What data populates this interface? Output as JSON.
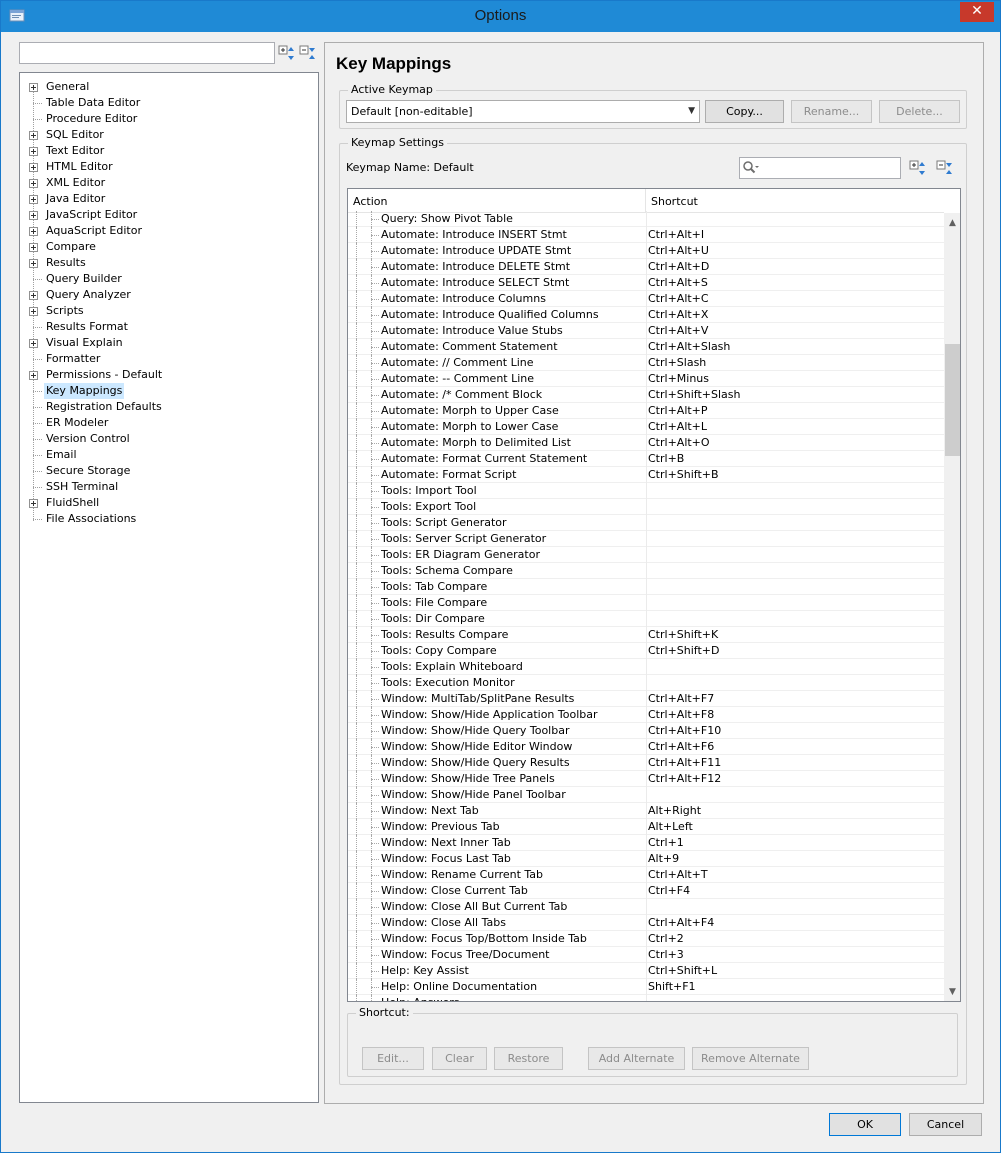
{
  "window": {
    "title": "Options",
    "close_glyph": "✕"
  },
  "nav": {
    "search_value": "",
    "items": [
      {
        "label": "General",
        "expandable": true
      },
      {
        "label": "Table Data Editor",
        "expandable": false
      },
      {
        "label": "Procedure Editor",
        "expandable": false
      },
      {
        "label": "SQL Editor",
        "expandable": true
      },
      {
        "label": "Text Editor",
        "expandable": true
      },
      {
        "label": "HTML Editor",
        "expandable": true
      },
      {
        "label": "XML Editor",
        "expandable": true
      },
      {
        "label": "Java Editor",
        "expandable": true
      },
      {
        "label": "JavaScript Editor",
        "expandable": true
      },
      {
        "label": "AquaScript Editor",
        "expandable": true
      },
      {
        "label": "Compare",
        "expandable": true
      },
      {
        "label": "Results",
        "expandable": true
      },
      {
        "label": "Query Builder",
        "expandable": false
      },
      {
        "label": "Query Analyzer",
        "expandable": true
      },
      {
        "label": "Scripts",
        "expandable": true
      },
      {
        "label": "Results Format",
        "expandable": false
      },
      {
        "label": "Visual Explain",
        "expandable": true
      },
      {
        "label": "Formatter",
        "expandable": false
      },
      {
        "label": "Permissions - Default",
        "expandable": true
      },
      {
        "label": "Key Mappings",
        "expandable": false,
        "selected": true
      },
      {
        "label": "Registration Defaults",
        "expandable": false
      },
      {
        "label": "ER Modeler",
        "expandable": false
      },
      {
        "label": "Version Control",
        "expandable": false
      },
      {
        "label": "Email",
        "expandable": false
      },
      {
        "label": "Secure Storage",
        "expandable": false
      },
      {
        "label": "SSH Terminal",
        "expandable": false
      },
      {
        "label": "FluidShell",
        "expandable": true
      },
      {
        "label": "File Associations",
        "expandable": false
      }
    ]
  },
  "page": {
    "title": "Key Mappings",
    "active_keymap": {
      "legend": "Active Keymap",
      "selected": "Default [non-editable]",
      "copy_label": "Copy...",
      "rename_label": "Rename...",
      "delete_label": "Delete..."
    },
    "settings": {
      "legend": "Keymap Settings",
      "keymap_name": "Keymap Name: Default",
      "filter_value": ""
    },
    "table": {
      "columns": [
        "Action",
        "Shortcut"
      ],
      "rows": [
        {
          "action": "Query: Show Pivot Table",
          "shortcut": ""
        },
        {
          "action": "Automate: Introduce INSERT Stmt",
          "shortcut": "Ctrl+Alt+I"
        },
        {
          "action": "Automate: Introduce UPDATE Stmt",
          "shortcut": "Ctrl+Alt+U"
        },
        {
          "action": "Automate: Introduce DELETE Stmt",
          "shortcut": "Ctrl+Alt+D"
        },
        {
          "action": "Automate: Introduce SELECT Stmt",
          "shortcut": "Ctrl+Alt+S"
        },
        {
          "action": "Automate: Introduce Columns",
          "shortcut": "Ctrl+Alt+C"
        },
        {
          "action": "Automate: Introduce Qualified Columns",
          "shortcut": "Ctrl+Alt+X"
        },
        {
          "action": "Automate: Introduce Value Stubs",
          "shortcut": "Ctrl+Alt+V"
        },
        {
          "action": "Automate: Comment Statement",
          "shortcut": "Ctrl+Alt+Slash"
        },
        {
          "action": "Automate: // Comment Line",
          "shortcut": "Ctrl+Slash"
        },
        {
          "action": "Automate: -- Comment Line",
          "shortcut": "Ctrl+Minus"
        },
        {
          "action": "Automate: /* Comment Block",
          "shortcut": "Ctrl+Shift+Slash"
        },
        {
          "action": "Automate: Morph to Upper Case",
          "shortcut": "Ctrl+Alt+P"
        },
        {
          "action": "Automate: Morph to Lower Case",
          "shortcut": "Ctrl+Alt+L"
        },
        {
          "action": "Automate: Morph to Delimited List",
          "shortcut": "Ctrl+Alt+O"
        },
        {
          "action": "Automate: Format Current Statement",
          "shortcut": "Ctrl+B"
        },
        {
          "action": "Automate: Format Script",
          "shortcut": "Ctrl+Shift+B"
        },
        {
          "action": "Tools: Import Tool",
          "shortcut": ""
        },
        {
          "action": "Tools: Export Tool",
          "shortcut": ""
        },
        {
          "action": "Tools: Script Generator",
          "shortcut": ""
        },
        {
          "action": "Tools: Server Script Generator",
          "shortcut": ""
        },
        {
          "action": "Tools: ER Diagram Generator",
          "shortcut": ""
        },
        {
          "action": "Tools: Schema Compare",
          "shortcut": ""
        },
        {
          "action": "Tools: Tab Compare",
          "shortcut": ""
        },
        {
          "action": "Tools: File Compare",
          "shortcut": ""
        },
        {
          "action": "Tools: Dir Compare",
          "shortcut": ""
        },
        {
          "action": "Tools: Results Compare",
          "shortcut": "Ctrl+Shift+K"
        },
        {
          "action": "Tools: Copy Compare",
          "shortcut": "Ctrl+Shift+D"
        },
        {
          "action": "Tools: Explain Whiteboard",
          "shortcut": ""
        },
        {
          "action": "Tools: Execution Monitor",
          "shortcut": ""
        },
        {
          "action": "Window: MultiTab/SplitPane Results",
          "shortcut": "Ctrl+Alt+F7"
        },
        {
          "action": "Window: Show/Hide Application Toolbar",
          "shortcut": "Ctrl+Alt+F8"
        },
        {
          "action": "Window: Show/Hide Query Toolbar",
          "shortcut": "Ctrl+Alt+F10"
        },
        {
          "action": "Window: Show/Hide Editor Window",
          "shortcut": "Ctrl+Alt+F6"
        },
        {
          "action": "Window: Show/Hide Query Results",
          "shortcut": "Ctrl+Alt+F11"
        },
        {
          "action": "Window: Show/Hide Tree Panels",
          "shortcut": "Ctrl+Alt+F12"
        },
        {
          "action": "Window: Show/Hide Panel Toolbar",
          "shortcut": ""
        },
        {
          "action": "Window: Next Tab",
          "shortcut": "Alt+Right"
        },
        {
          "action": "Window: Previous Tab",
          "shortcut": "Alt+Left"
        },
        {
          "action": "Window: Next Inner Tab",
          "shortcut": "Ctrl+1"
        },
        {
          "action": "Window: Focus Last Tab",
          "shortcut": "Alt+9"
        },
        {
          "action": "Window: Rename Current Tab",
          "shortcut": "Ctrl+Alt+T"
        },
        {
          "action": "Window: Close Current Tab",
          "shortcut": "Ctrl+F4"
        },
        {
          "action": "Window: Close All But Current Tab",
          "shortcut": ""
        },
        {
          "action": "Window: Close All Tabs",
          "shortcut": "Ctrl+Alt+F4"
        },
        {
          "action": "Window: Focus Top/Bottom Inside Tab",
          "shortcut": "Ctrl+2"
        },
        {
          "action": "Window: Focus Tree/Document",
          "shortcut": "Ctrl+3"
        },
        {
          "action": "Help: Key Assist",
          "shortcut": "Ctrl+Shift+L"
        },
        {
          "action": "Help: Online Documentation",
          "shortcut": "Shift+F1"
        },
        {
          "action": "Help: Answers",
          "shortcut": ""
        }
      ]
    },
    "shortcut_group": {
      "legend": "Shortcut:",
      "edit_label": "Edit...",
      "clear_label": "Clear",
      "restore_label": "Restore",
      "add_alternate_label": "Add Alternate",
      "remove_alternate_label": "Remove Alternate"
    }
  },
  "footer": {
    "ok_label": "OK",
    "cancel_label": "Cancel"
  },
  "colors": {
    "titlebar": "#1f8ad6",
    "close": "#c7392b",
    "selection": "#cce8ff"
  }
}
